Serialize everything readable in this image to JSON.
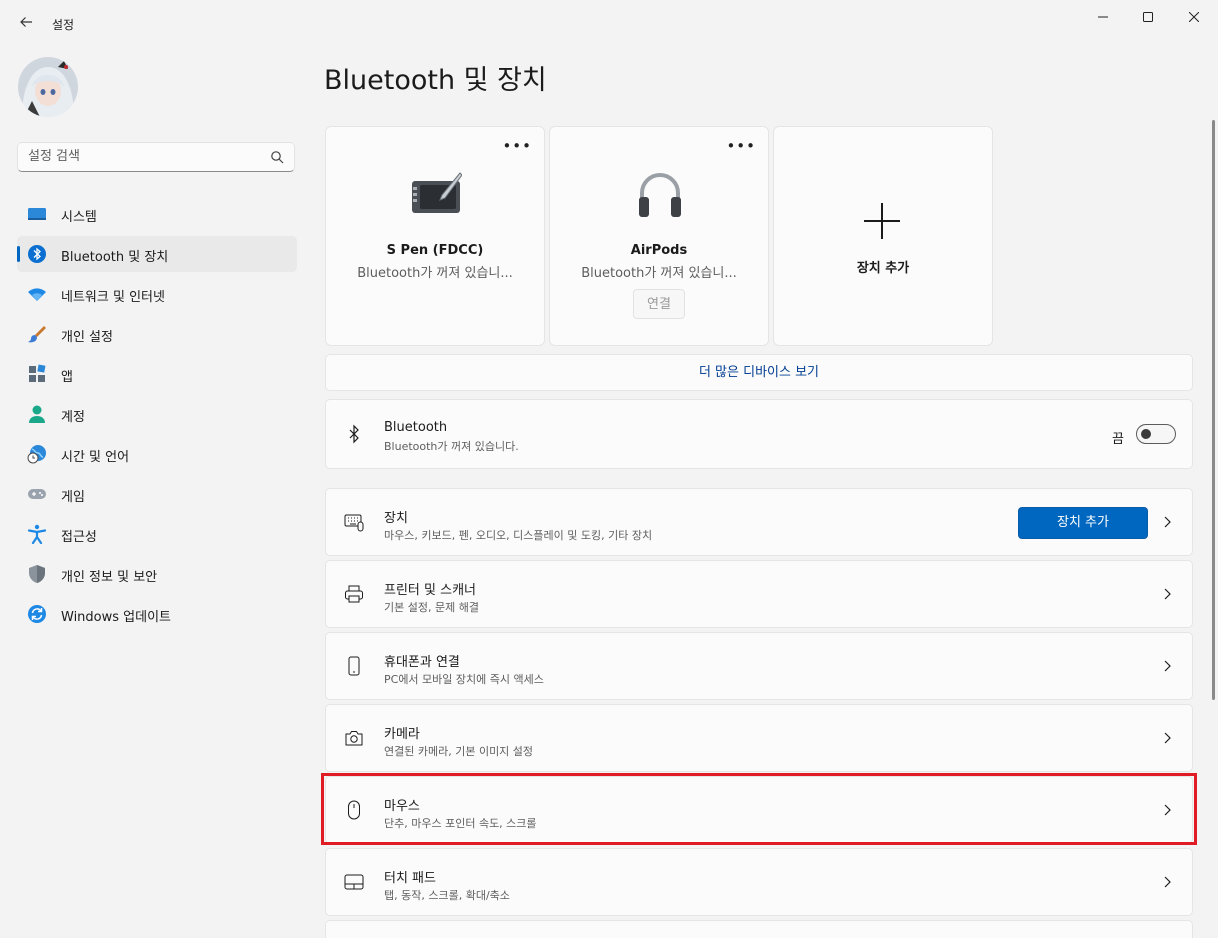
{
  "window": {
    "title": "설정",
    "back_icon": "back-arrow-icon",
    "minimize_icon": "minimize-icon",
    "maximize_icon": "maximize-icon",
    "close_icon": "close-icon"
  },
  "search": {
    "placeholder": "설정 검색",
    "value": ""
  },
  "sidebar": {
    "items": [
      {
        "label": "시스템",
        "icon": "system-icon",
        "active": false
      },
      {
        "label": "Bluetooth 및 장치",
        "icon": "bluetooth-icon",
        "active": true
      },
      {
        "label": "네트워크 및 인터넷",
        "icon": "wifi-icon",
        "active": false
      },
      {
        "label": "개인 설정",
        "icon": "brush-icon",
        "active": false
      },
      {
        "label": "앱",
        "icon": "apps-icon",
        "active": false
      },
      {
        "label": "계정",
        "icon": "person-icon",
        "active": false
      },
      {
        "label": "시간 및 언어",
        "icon": "globe-clock-icon",
        "active": false
      },
      {
        "label": "게임",
        "icon": "gamepad-icon",
        "active": false
      },
      {
        "label": "접근성",
        "icon": "accessibility-icon",
        "active": false
      },
      {
        "label": "개인 정보 및 보안",
        "icon": "shield-icon",
        "active": false
      },
      {
        "label": "Windows 업데이트",
        "icon": "update-icon",
        "active": false
      }
    ]
  },
  "page": {
    "title": "Bluetooth 및 장치"
  },
  "devices": [
    {
      "name": "S Pen (FDCC)",
      "status": "Bluetooth가 꺼져 있습니...",
      "icon": "pen-tablet-icon"
    },
    {
      "name": "AirPods",
      "status": "Bluetooth가 꺼져 있습니...",
      "icon": "headphones-icon",
      "connect_label": "연결"
    }
  ],
  "add_device_card": {
    "label": "장치 추가",
    "icon": "plus-icon"
  },
  "more_devices_label": "더 많은 디바이스 보기",
  "bluetooth_row": {
    "title": "Bluetooth",
    "subtitle": "Bluetooth가 꺼져 있습니다.",
    "toggle_label": "끔",
    "toggle_on": false
  },
  "settings_rows": [
    {
      "title": "장치",
      "subtitle": "마우스, 키보드, 펜, 오디오, 디스플레이 및 도킹, 기타 장치",
      "icon": "keyboard-device-icon",
      "button_label": "장치 추가"
    },
    {
      "title": "프린터 및 스캐너",
      "subtitle": "기본 설정, 문제 해결",
      "icon": "printer-icon"
    },
    {
      "title": "휴대폰과 연결",
      "subtitle": "PC에서 모바일 장치에 즉시 액세스",
      "icon": "phone-icon"
    },
    {
      "title": "카메라",
      "subtitle": "연결된 카메라, 기본 이미지 설정",
      "icon": "camera-icon"
    },
    {
      "title": "마우스",
      "subtitle": "단추, 마우스 포인터 속도, 스크롤",
      "icon": "mouse-icon",
      "highlighted": true
    },
    {
      "title": "터치 패드",
      "subtitle": "탭, 동작, 스크롤, 확대/축소",
      "icon": "touchpad-icon"
    }
  ],
  "colors": {
    "accent": "#0067c0",
    "highlight_border": "#e01b24",
    "link": "#003e92"
  }
}
